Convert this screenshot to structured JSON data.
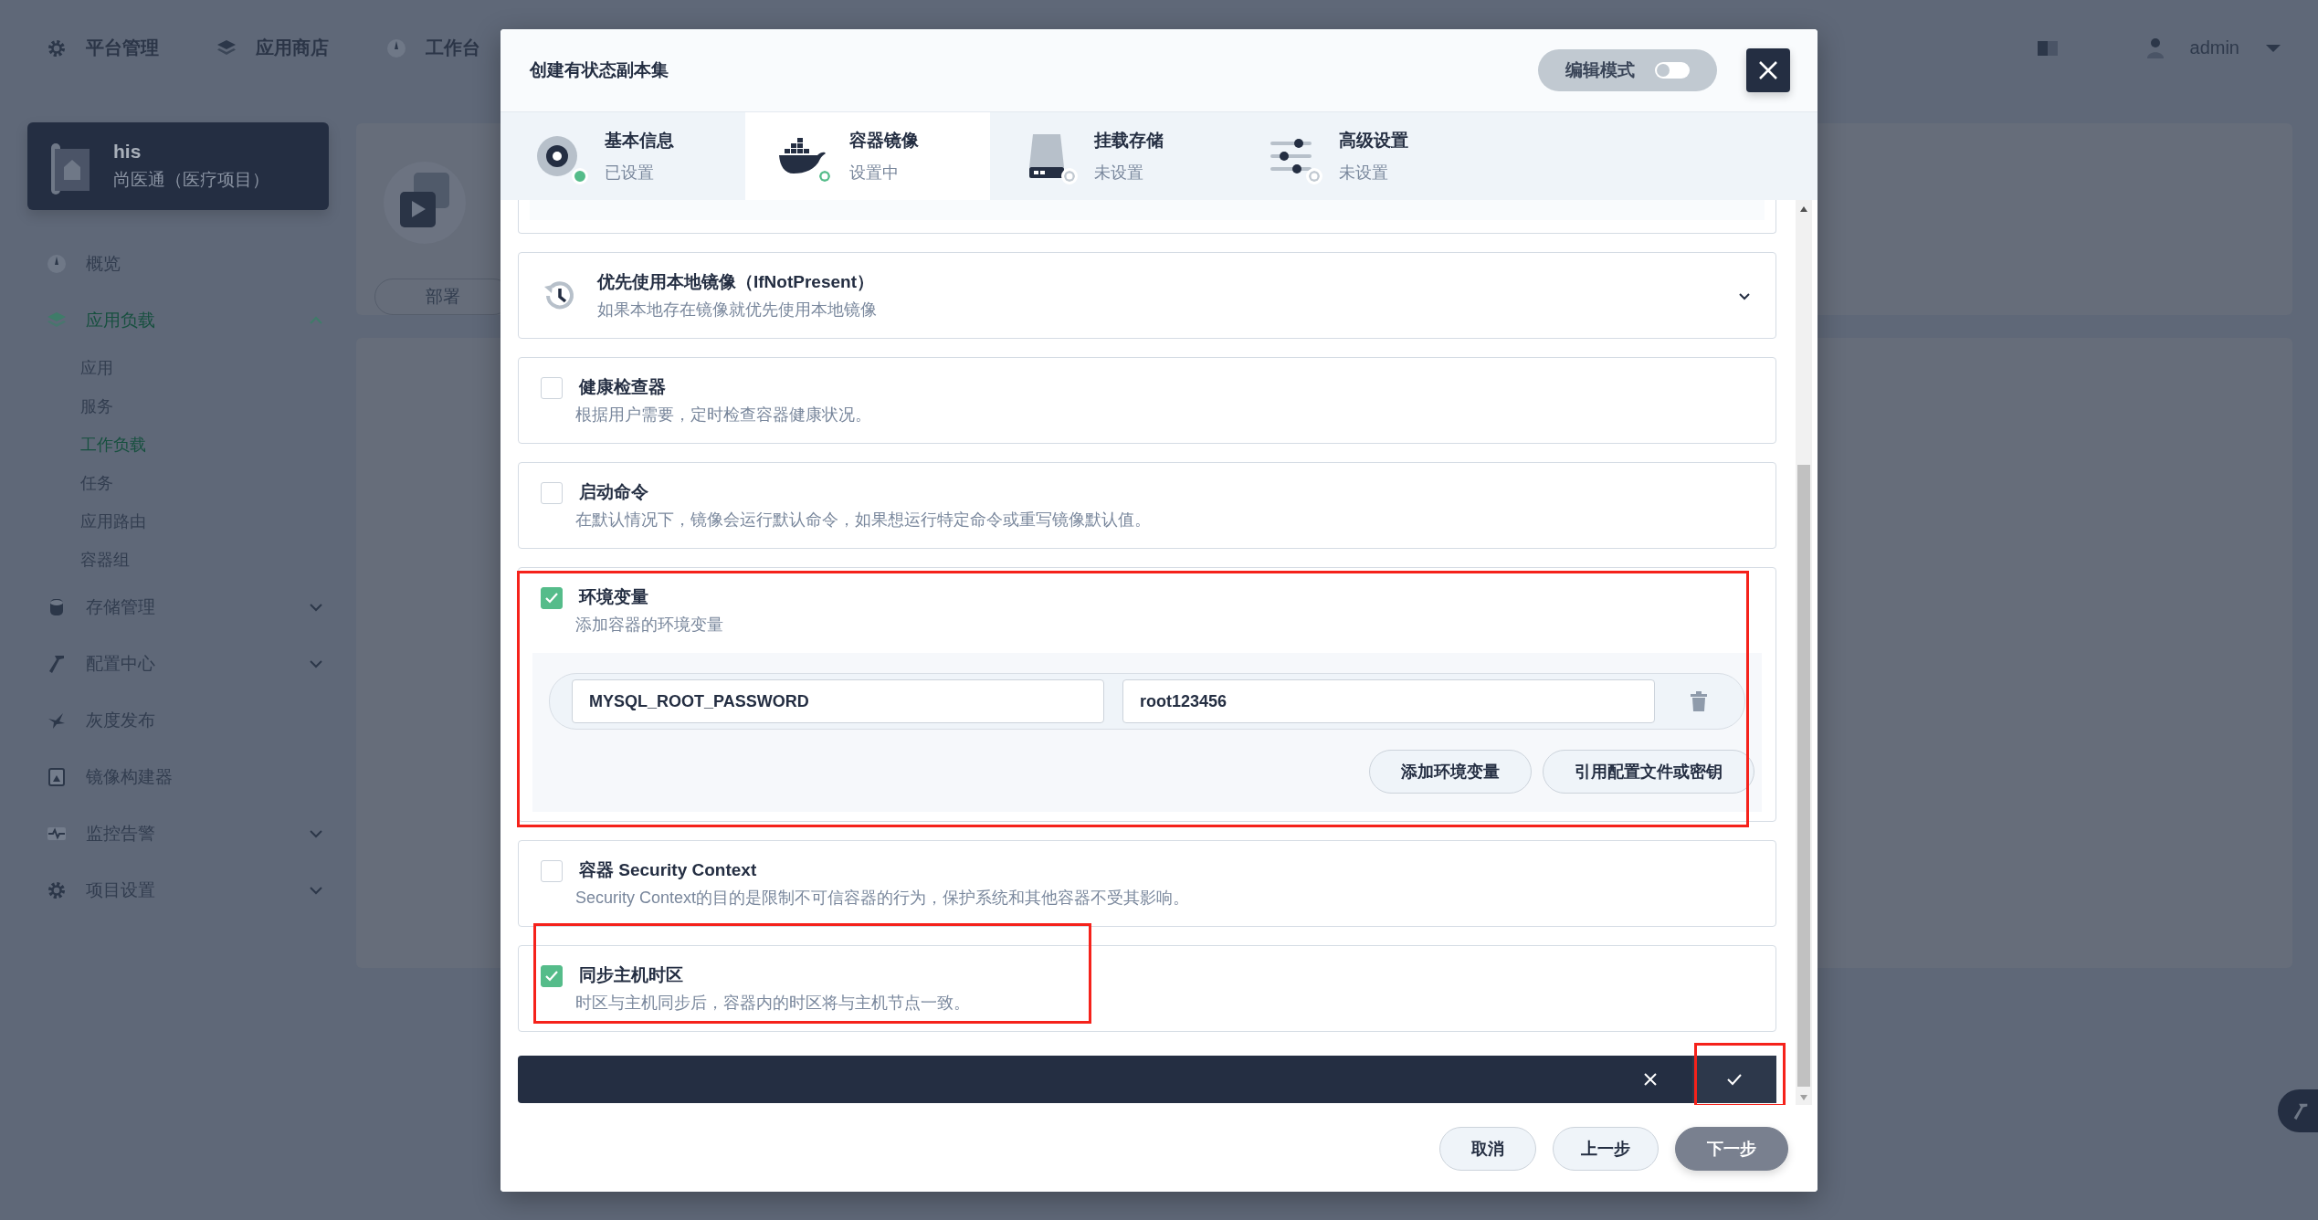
{
  "top_nav": {
    "items": [
      {
        "label": "平台管理",
        "kind": "gear"
      },
      {
        "label": "应用商店",
        "kind": "layers"
      },
      {
        "label": "工作台",
        "kind": "dial"
      }
    ],
    "user": "admin"
  },
  "project": {
    "name": "his",
    "description": "尚医通（医疗项目）"
  },
  "sidebar": {
    "items": [
      {
        "label": "概览",
        "kind": "dial",
        "selected": false
      },
      {
        "label": "应用负载",
        "kind": "layers",
        "selected": true,
        "expanded": true,
        "children": [
          {
            "label": "应用",
            "selected": false
          },
          {
            "label": "服务",
            "selected": false
          },
          {
            "label": "工作负载",
            "selected": true
          },
          {
            "label": "任务",
            "selected": false
          },
          {
            "label": "应用路由",
            "selected": false
          },
          {
            "label": "容器组",
            "selected": false
          }
        ]
      },
      {
        "label": "存储管理",
        "kind": "database",
        "selected": false,
        "expanded": false
      },
      {
        "label": "配置中心",
        "kind": "hammer",
        "selected": false,
        "expanded": false
      },
      {
        "label": "灰度发布",
        "kind": "bird",
        "selected": false
      },
      {
        "label": "镜像构建器",
        "kind": "image",
        "selected": false
      },
      {
        "label": "监控告警",
        "kind": "pulse",
        "selected": false,
        "expanded": false
      },
      {
        "label": "项目设置",
        "kind": "gear",
        "selected": false,
        "expanded": false
      }
    ]
  },
  "page": {
    "tab": "部署"
  },
  "modal": {
    "title": "创建有状态副本集",
    "edit_mode": {
      "label": "编辑模式",
      "on": false
    },
    "steps": [
      {
        "title": "基本信息",
        "status": "已设置",
        "kind": "disc",
        "completed": true,
        "selected": false
      },
      {
        "title": "容器镜像",
        "status": "设置中",
        "kind": "whale",
        "completed": false,
        "selected": true
      },
      {
        "title": "挂载存储",
        "status": "未设置",
        "kind": "drive",
        "completed": false,
        "selected": false
      },
      {
        "title": "高级设置",
        "status": "未设置",
        "kind": "sliders",
        "completed": false,
        "selected": false
      }
    ],
    "sections": [
      {
        "kind": "policy",
        "title": "优先使用本地镜像（IfNotPresent）",
        "description": "如果本地存在镜像就优先使用本地镜像",
        "expanded": false,
        "highlighted": false
      },
      {
        "kind": "option",
        "title": "健康检查器",
        "description": "根据用户需要，定时检查容器健康状况。",
        "checked": false,
        "highlighted": false
      },
      {
        "kind": "option",
        "title": "启动命令",
        "description": "在默认情况下，镜像会运行默认命令，如果想运行特定命令或重写镜像默认值。",
        "checked": false,
        "highlighted": false
      },
      {
        "kind": "env",
        "title": "环境变量",
        "description": "添加容器的环境变量",
        "checked": true,
        "highlighted": true,
        "env_vars": [
          {
            "name": "MYSQL_ROOT_PASSWORD",
            "value": "root123456"
          }
        ],
        "buttons": [
          "添加环境变量",
          "引用配置文件或密钥"
        ]
      },
      {
        "kind": "option",
        "title": "容器 Security Context",
        "description": "Security Context的目的是限制不可信容器的行为，保护系统和其他容器不受其影响。",
        "checked": false,
        "highlighted": false
      },
      {
        "kind": "option",
        "title": "同步主机时区",
        "description": "时区与主机同步后，容器内的时区将与主机节点一致。",
        "checked": true,
        "highlighted": true
      }
    ],
    "action_bar": {
      "confirm_highlighted": true
    },
    "footer_buttons": [
      {
        "label": "取消",
        "kind": "default"
      },
      {
        "label": "上一步",
        "kind": "default"
      },
      {
        "label": "下一步",
        "kind": "primary"
      }
    ]
  }
}
